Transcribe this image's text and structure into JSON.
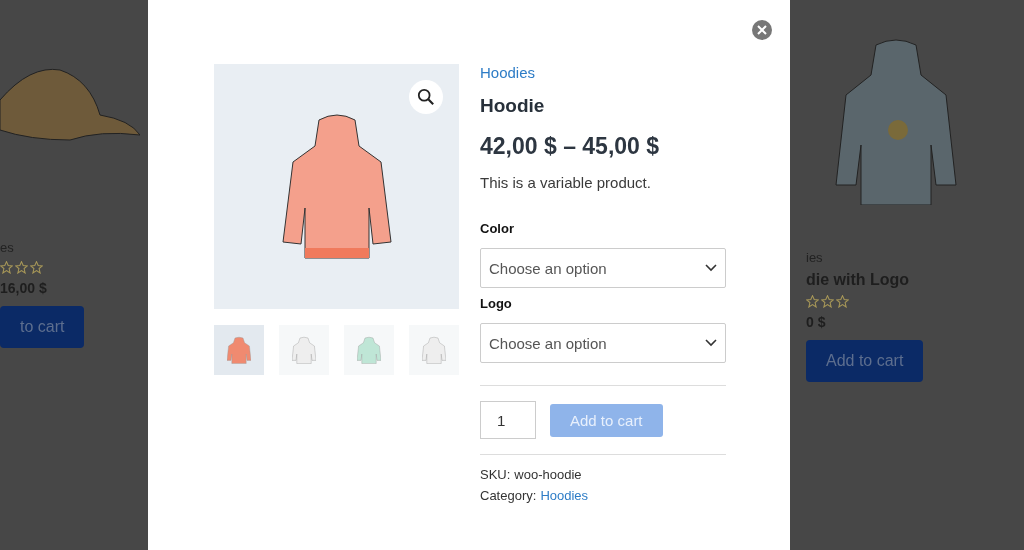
{
  "background_products": [
    {
      "category": "es",
      "stars": 0,
      "price": "16,00 $",
      "button": "to cart"
    },
    {
      "category": "ies",
      "name": "die with Logo",
      "stars": 0,
      "price": "0 $",
      "button": "Add to cart"
    }
  ],
  "modal": {
    "gallery": {
      "thumbnails": [
        {
          "color": "#f08a70",
          "selected": true
        },
        {
          "color": "#eeeeee",
          "selected": false
        },
        {
          "color": "#bfe6d6",
          "selected": false
        },
        {
          "color": "#eeeeee",
          "selected": false
        }
      ]
    },
    "category": "Hoodies",
    "title": "Hoodie",
    "price": "42,00 $ – 45,00 $",
    "description": "This is a variable product.",
    "attributes": [
      {
        "label": "Color",
        "placeholder": "Choose an option"
      },
      {
        "label": "Logo",
        "placeholder": "Choose an option"
      }
    ],
    "quantity": "1",
    "add_to_cart": {
      "label": "Add to cart",
      "disabled": true
    },
    "meta": [
      {
        "label": "SKU:",
        "value": "woo-hoodie",
        "kind": "text"
      },
      {
        "label": "Category:",
        "value": "Hoodies",
        "kind": "link"
      }
    ]
  }
}
